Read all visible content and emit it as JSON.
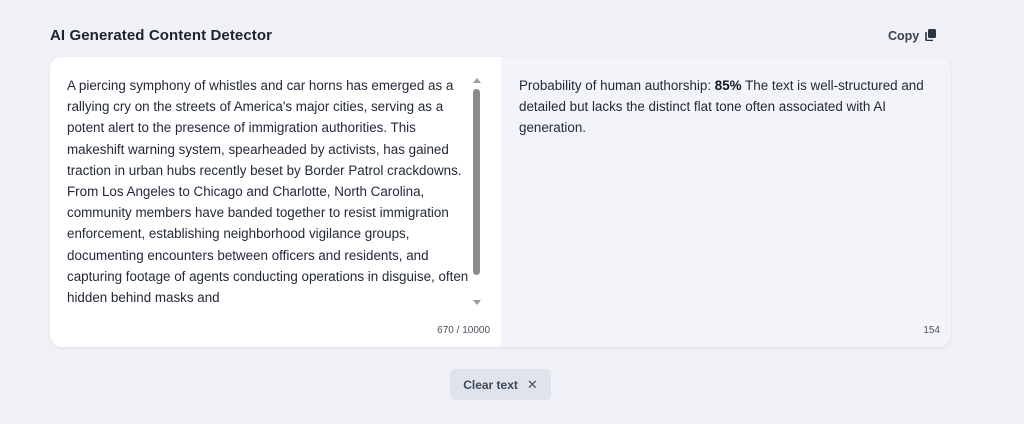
{
  "header": {
    "title": "AI Generated Content Detector",
    "copy_label": "Copy",
    "copy_icon": "copy-icon"
  },
  "input": {
    "text": "A piercing symphony of whistles and car horns has emerged as a rallying cry on the streets of America's major cities, serving as a potent alert to the presence of immigration authorities. This makeshift warning system, spearheaded by activists, has gained traction in urban hubs recently beset by Border Patrol crackdowns. From Los Angeles to Chicago and Charlotte, North Carolina, community members have banded together to resist immigration enforcement, establishing neighborhood vigilance groups, documenting encounters between officers and residents, and capturing footage of agents conducting operations in disguise, often hidden behind masks and",
    "char_count": "670 / 10000"
  },
  "result": {
    "prefix": "Probability of human authorship: ",
    "percentage": "85%",
    "explanation": " The text is well-structured and detailed but lacks the distinct flat tone often associated with AI generation.",
    "count": "154"
  },
  "actions": {
    "clear_label": "Clear text",
    "clear_icon": "✕"
  }
}
